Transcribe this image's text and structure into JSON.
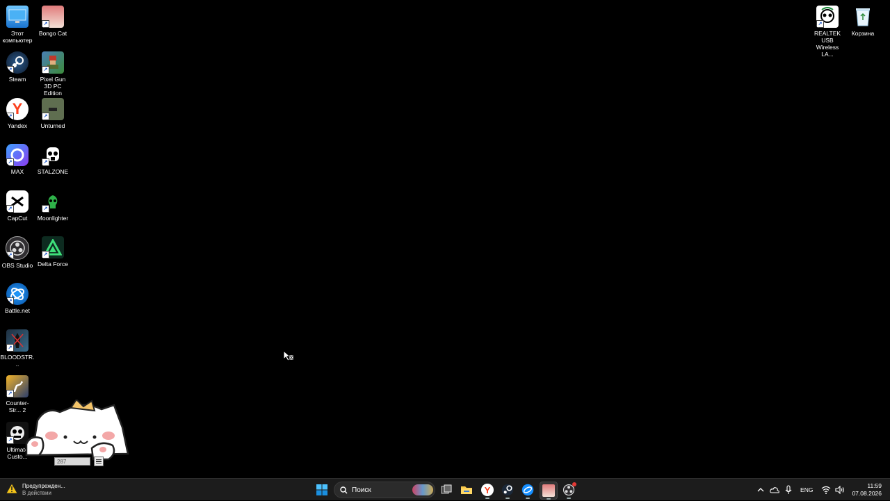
{
  "desktop": {
    "icons_left": [
      {
        "label": "Этот компьютер",
        "icon": "monitor-icon",
        "color": "#2a8ae0",
        "shortcut": false
      },
      {
        "label": "Bongo Cat",
        "icon": "bongo-cat-icon",
        "color": "#e8a0a0",
        "shortcut": true
      },
      {
        "label": "Steam",
        "icon": "steam-icon",
        "color": "#1b2838",
        "shortcut": true
      },
      {
        "label": "Pixel Gun 3D PC Edition",
        "icon": "pixel-gun-icon",
        "color": "#3d6b9a",
        "shortcut": true
      },
      {
        "label": "Yandex",
        "icon": "yandex-icon",
        "color": "#ffffff",
        "shortcut": true
      },
      {
        "label": "Unturned",
        "icon": "unturned-icon",
        "color": "#6c7a5a",
        "shortcut": true
      },
      {
        "label": "MAX",
        "icon": "max-messenger-icon",
        "color": "#6a3df0",
        "shortcut": true
      },
      {
        "label": "STALZONE",
        "icon": "stalzone-icon",
        "color": "#ffffff",
        "shortcut": true
      },
      {
        "label": "CapCut",
        "icon": "capcut-icon",
        "color": "#ffffff",
        "shortcut": true
      },
      {
        "label": "Moonlighter",
        "icon": "moonlighter-icon",
        "color": "#2f8a3a",
        "shortcut": true
      },
      {
        "label": "OBS Studio",
        "icon": "obs-icon",
        "color": "#302e31",
        "shortcut": true
      },
      {
        "label": "Delta Force",
        "icon": "delta-force-icon",
        "color": "#0f3a2a",
        "shortcut": true
      },
      {
        "label": "Battle.net",
        "icon": "battlenet-icon",
        "color": "#148eff",
        "shortcut": true
      },
      {
        "label": "BLOODSTR...",
        "icon": "bloodstrike-icon",
        "color": "#1a2a3a",
        "shortcut": true
      },
      {
        "label": "Counter-Str... 2",
        "icon": "counter-strike-icon",
        "color": "#e8a628",
        "shortcut": true
      },
      {
        "label": "Ultimate Custo...",
        "icon": "ultimate-custom-night-icon",
        "color": "#222222",
        "shortcut": true
      }
    ],
    "icons_right": [
      {
        "label": "REALTEK USB Wireless LA...",
        "icon": "realtek-wifi-icon",
        "color": "#ffffff",
        "shortcut": true
      },
      {
        "label": "Корзина",
        "icon": "recycle-bin-icon",
        "color": "#cfe6f5",
        "shortcut": false
      }
    ]
  },
  "bongo": {
    "counter_value": "287"
  },
  "taskbar": {
    "widget": {
      "title": "Предупрежден...",
      "subtitle": "В действии",
      "icon": "warning-icon"
    },
    "search_placeholder": "Поиск",
    "apps": [
      {
        "name": "start-button",
        "icon": "windows-logo-icon"
      },
      {
        "name": "task-view-button",
        "icon": "task-view-icon"
      },
      {
        "name": "file-explorer-button",
        "icon": "folder-icon"
      },
      {
        "name": "yandex-browser-button",
        "icon": "yandex-icon"
      },
      {
        "name": "steam-button",
        "icon": "steam-icon"
      },
      {
        "name": "battlenet-button",
        "icon": "battlenet-icon"
      },
      {
        "name": "bongo-cat-button",
        "icon": "bongo-cat-icon"
      },
      {
        "name": "obs-button",
        "icon": "obs-icon"
      }
    ],
    "tray": {
      "language": "ENG",
      "time": "11:59",
      "date": "07.08.2026"
    }
  },
  "colors": {
    "desktop_background": "#000000",
    "taskbar_background": "#1c1c1c",
    "accent": "#0078d4"
  }
}
